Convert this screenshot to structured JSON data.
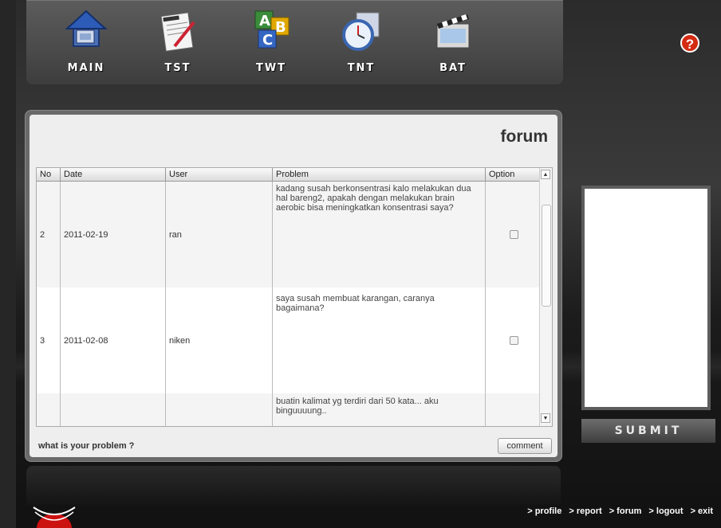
{
  "nav": {
    "items": [
      {
        "label": "MAIN",
        "icon": "house-icon"
      },
      {
        "label": "TST",
        "icon": "rich-text-icon"
      },
      {
        "label": "TWT",
        "icon": "abc-blocks-icon"
      },
      {
        "label": "TNT",
        "icon": "clock-icon"
      },
      {
        "label": "BAT",
        "icon": "clapperboard-icon"
      }
    ]
  },
  "help_symbol": "?",
  "forum": {
    "title": "forum",
    "columns": [
      "No",
      "Date",
      "User",
      "Problem",
      "Option"
    ],
    "rows": [
      {
        "no": "2",
        "date": "2011-02-19",
        "user": "ran",
        "problem": "kadang susah berkonsentrasi kalo melakukan dua hal bareng2, apakah dengan melakukan brain aerobic bisa meningkatkan konsentrasi saya?"
      },
      {
        "no": "3",
        "date": "2011-02-08",
        "user": "niken",
        "problem": "saya susah membuat karangan, caranya bagaimana?"
      },
      {
        "no": "",
        "date": "",
        "user": "",
        "problem": "buatin kalimat yg terdiri dari 50 kata... aku binguuuung.."
      }
    ],
    "question_label": "what is your problem ?",
    "comment_label": "comment"
  },
  "submit_label": "SUBMIT",
  "footer_links": [
    "> profile",
    "> report",
    "> forum",
    "> logout",
    "> exit"
  ],
  "colors": {
    "help": "#d42a12",
    "logo": "#cc1111"
  }
}
